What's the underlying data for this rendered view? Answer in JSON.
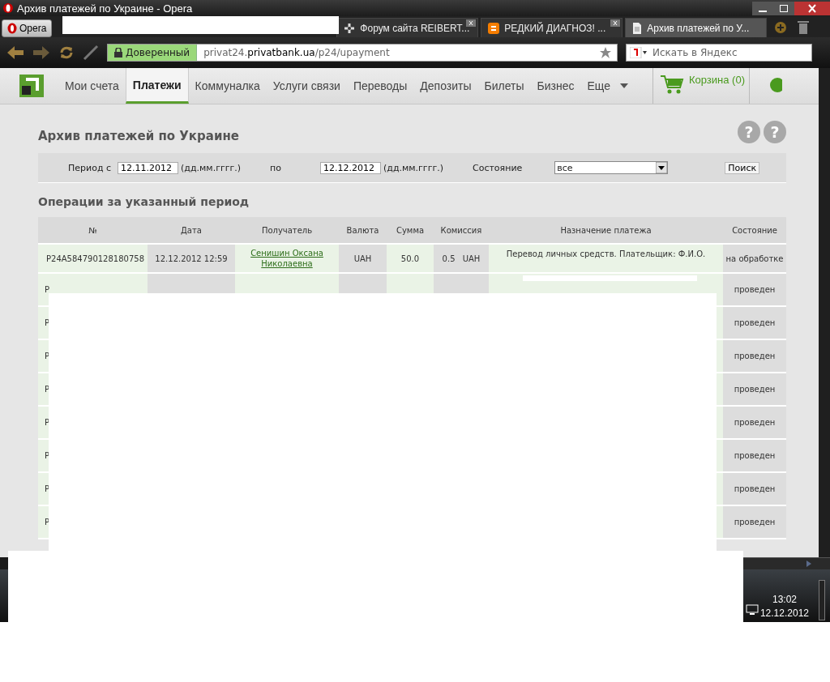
{
  "window": {
    "title": "Архив платежей по Украине - Opera"
  },
  "browser": {
    "menu_button": "Opera",
    "tabs": [
      {
        "label": "Форум сайта REIBERT...",
        "selected": false
      },
      {
        "label": "РЕДКИЙ ДИАГНОЗ! ...",
        "selected": false
      },
      {
        "label": "Архив платежей по У...",
        "selected": true
      }
    ],
    "security_badge": "Доверенный",
    "url": {
      "prefix": "privat24.",
      "host": "privatbank.ua",
      "path": "/p24/upayment"
    },
    "search": {
      "placeholder": "Искать в Яндекс"
    }
  },
  "nav": {
    "items": [
      {
        "label": "Мои счета",
        "selected": false
      },
      {
        "label": "Платежи",
        "selected": true
      },
      {
        "label": "Коммуналка",
        "selected": false
      },
      {
        "label": "Услуги связи",
        "selected": false
      },
      {
        "label": "Переводы",
        "selected": false
      },
      {
        "label": "Депозиты",
        "selected": false
      },
      {
        "label": "Билеты",
        "selected": false
      },
      {
        "label": "Бизнес",
        "selected": false
      },
      {
        "label": "Еще",
        "selected": false
      }
    ],
    "cart": "Корзина (0)"
  },
  "page_title": "Архив платежей по Украине",
  "help_buttons": [
    "?",
    "?"
  ],
  "filter": {
    "from_label": "Период с",
    "from_value": "12.11.2012",
    "from_hint": "(дд.мм.гггг.)",
    "to_label": "по",
    "to_value": "12.12.2012",
    "to_hint": "(дд.мм.гггг.)",
    "status_label": "Состояние",
    "status_value": "все",
    "search_button": "Поиск"
  },
  "section_title": "Операции за указанный период",
  "table": {
    "columns": [
      "№",
      "Дата",
      "Получатель",
      "Валюта",
      "Сумма",
      "Комиссия",
      "Назначение платежа",
      "Состояние"
    ],
    "rows": [
      {
        "number": "P24A584790128180758",
        "date": "12.12.2012 12:59",
        "recipient": "Сенишин Оксана Николаевна",
        "currency": "UAH",
        "amount": "50.0",
        "commission": {
          "value": "0.5",
          "currency": "UAH"
        },
        "purpose": "Перевод личных средств. Плательщик: Ф.И.О.",
        "status": "на обработке"
      },
      {
        "number": "P",
        "status": "проведен"
      },
      {
        "number": "P",
        "status": "проведен"
      },
      {
        "number": "P",
        "status": "проведен"
      },
      {
        "number": "P",
        "status": "проведен"
      },
      {
        "number": "P",
        "status": "проведен"
      },
      {
        "number": "P",
        "status": "проведен"
      },
      {
        "number": "P",
        "status": "проведен"
      },
      {
        "number": "P",
        "status": "проведен"
      }
    ]
  },
  "taskbar": {
    "time": "13:02",
    "date": "12.12.2012"
  }
}
